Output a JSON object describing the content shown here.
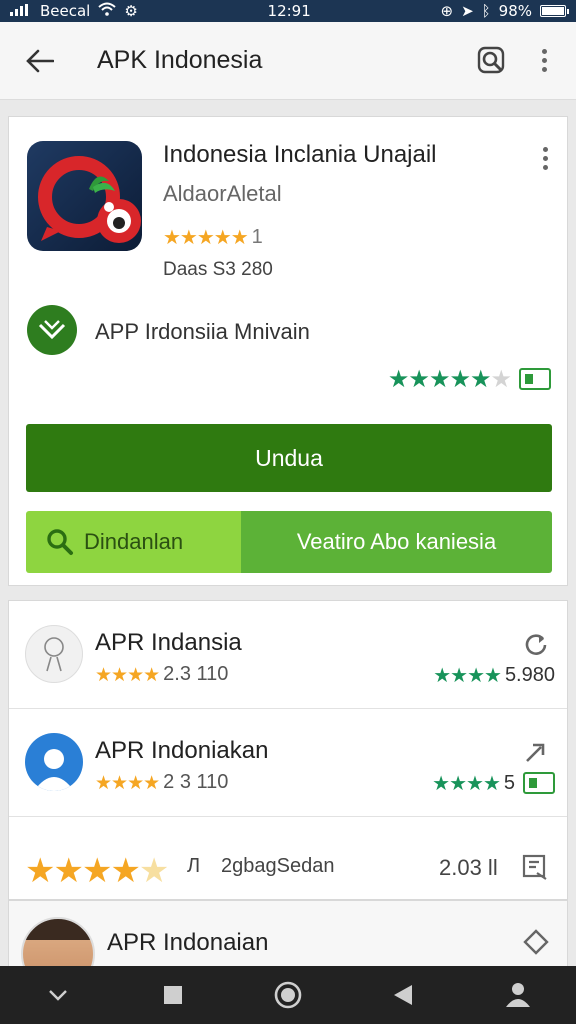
{
  "status_bar": {
    "carrier": "Beecal",
    "time": "12:91",
    "battery": "98%"
  },
  "app_bar": {
    "title": "APK Indonesia"
  },
  "app": {
    "name": "Indonesia Inclania Unajail",
    "developer": "AldaorAletal",
    "rating_stars": "★★★★★",
    "rating_count": "1",
    "downloads": "Daas S3 280"
  },
  "badge": {
    "label": "APP Irdonsiia Mnivain",
    "stars_on": "★★★★★",
    "stars_off": "★"
  },
  "buttons": {
    "install": "Undua",
    "secondary_left": "Dindanlan",
    "secondary_right": "Veatiro Abo kaniesia"
  },
  "list": [
    {
      "title": "APR Indansia",
      "stars": "★★★★",
      "rating": "2.3 110",
      "right_stars": "★★★★",
      "right_value": "5.980"
    },
    {
      "title": "APR Indoniakan",
      "stars": "★★★★",
      "rating": "2 3 110",
      "right_stars": "★★★★",
      "right_value": "5"
    },
    {
      "stars": "★★★★",
      "stars_half": "★",
      "label_a": "Л",
      "label_b": "2gbagSedan",
      "value": "2.03 ll"
    },
    {
      "title": "APR Indonaian"
    }
  ],
  "colors": {
    "accent": "#2f7a10",
    "light_green": "#8ed540",
    "gold": "#f5a623",
    "status_bar": "#1c3553"
  }
}
